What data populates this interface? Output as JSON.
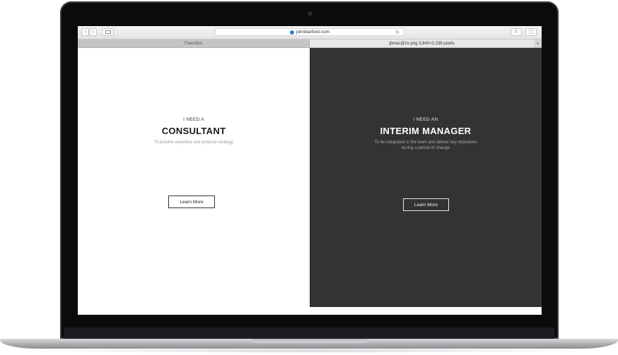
{
  "browser": {
    "address": "johnbarford.com",
    "tabs": [
      {
        "label": "Favorites"
      },
      {
        "label": "jbmac@2x.png 3,840×2,158 pixels"
      }
    ],
    "new_tab_label": "+"
  },
  "panels": {
    "left": {
      "eyebrow": "I NEED A",
      "heading": "CONSULTANT",
      "subtitle": "To provide expertise and propose strategy",
      "button": "Learn More"
    },
    "right": {
      "eyebrow": "I NEED AN",
      "heading": "INTERIM MANAGER",
      "subtitle_line1": "To be integrated in the team and deliver key objectives",
      "subtitle_line2": "during a period of change",
      "button": "Learn More"
    }
  },
  "colors": {
    "left_bg": "#ffffff",
    "right_bg": "#333333",
    "laptop_bezel": "#0b0b0c"
  }
}
